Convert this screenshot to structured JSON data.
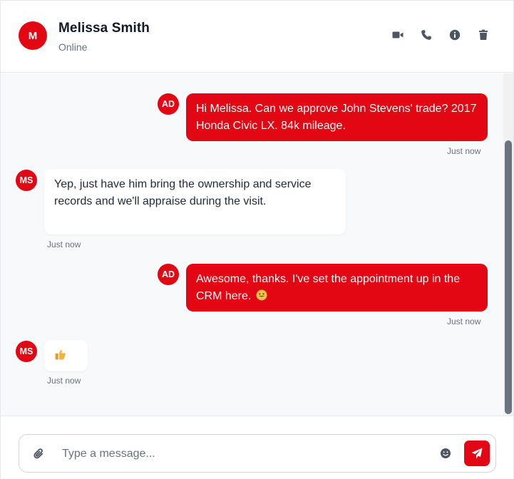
{
  "contact": {
    "initial": "M",
    "name": "Melissa Smith",
    "status": "Online"
  },
  "header_actions": [
    "video-icon",
    "phone-icon",
    "info-icon",
    "trash-icon"
  ],
  "messages": [
    {
      "from": "AD",
      "direction": "out",
      "text": "Hi Melissa. Can we approve John Stevens' trade? 2017 Honda Civic LX. 84k mileage.",
      "time": "Just now"
    },
    {
      "from": "MS",
      "direction": "in",
      "text": "Yep, just have him bring the ownership and service records and we'll appraise during the visit.",
      "time": "Just now"
    },
    {
      "from": "AD",
      "direction": "out",
      "text": "Awesome, thanks. I've set the appointment up in the CRM here.",
      "emoji": "😄",
      "time": "Just now"
    },
    {
      "from": "MS",
      "direction": "in",
      "text": "👍",
      "time": "Just now"
    }
  ],
  "composer": {
    "placeholder": "Type a message..."
  },
  "colors": {
    "accent": "#e30613",
    "background": "#f8f9fb",
    "muted_text": "#6b7280"
  }
}
